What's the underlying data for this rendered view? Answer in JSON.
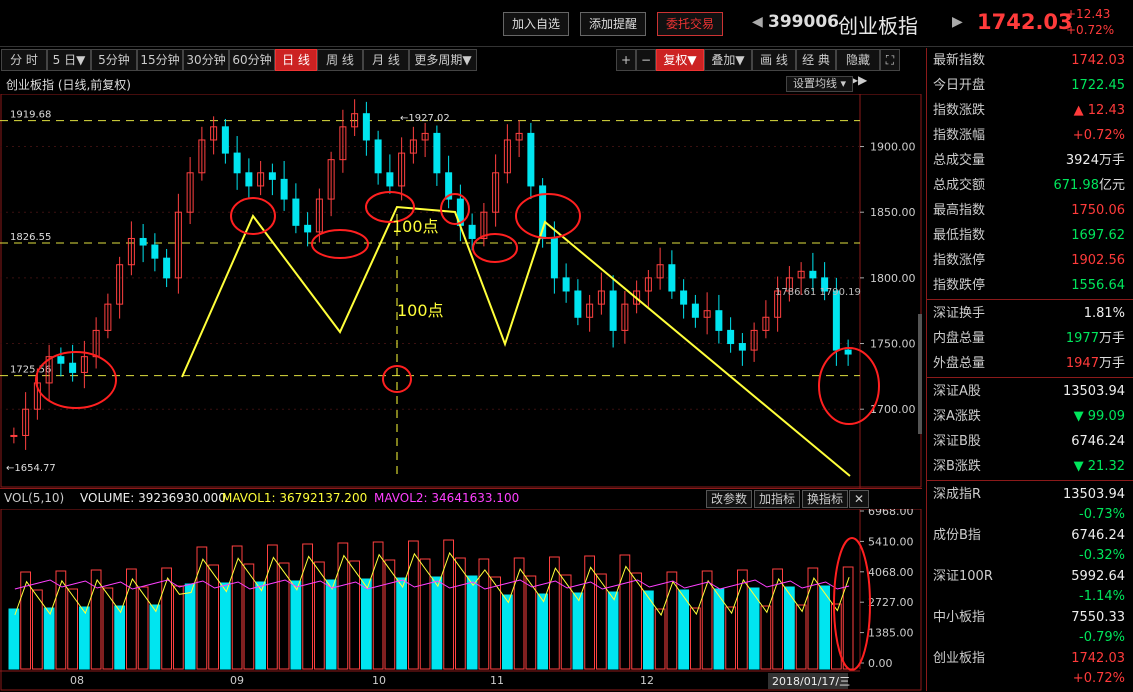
{
  "header": {
    "buttons": [
      "加入自选",
      "添加提醒",
      "委托交易"
    ],
    "code": "399006",
    "name": "创业板指",
    "price": "1742.03",
    "change": "+12.43",
    "change_pct": "+0.72%",
    "prev_arrow": "◀",
    "next_arrow": "▶"
  },
  "toolbar": {
    "left_tabs": [
      "分 时",
      "5 日▼",
      "5分钟",
      "15分钟",
      "30分钟",
      "60分钟",
      "日 线",
      "周 线",
      "月 线",
      "更多周期▼"
    ],
    "active_tab": "日 线",
    "right_tools": [
      "+",
      "−",
      "复权▼",
      "叠加▼",
      "画 线",
      "经 典",
      "隐藏▶▶",
      "⛶"
    ],
    "active_tool": "复权▼"
  },
  "chart_title": "创业板指 (日线,前复权)",
  "ma_setting": "设置均线",
  "price_levels": {
    "high_label": "1919.68",
    "mid_label": "1826.55",
    "low_label": "1725.56",
    "min_label": "←1654.77",
    "peak_label": "←1927.02",
    "right_labels": "1786.61 1790.19"
  },
  "annotations": {
    "hundred1": "100点",
    "hundred2": "100点"
  },
  "price_axis": [
    "1900.00",
    "1850.00",
    "1800.00",
    "1750.00",
    "1700.00"
  ],
  "volume": {
    "label": "VOL(5,10)",
    "volume_text": "VOLUME: 39236930.000",
    "mavol1": "MAVOL1: 36792137.200",
    "mavol2": "MAVOL2: 34641633.100",
    "buttons": [
      "改参数",
      "加指标",
      "换指标",
      "✕"
    ],
    "axis": [
      "6968.00",
      "5410.00",
      "4068.00",
      "2727.00",
      "1385.00",
      "0.00"
    ]
  },
  "x_axis": [
    "08",
    "09",
    "10",
    "11",
    "12"
  ],
  "x_date": "2018/01/17/三",
  "right_panel": {
    "group1": [
      {
        "label": "最新指数",
        "value": "1742.03",
        "color": "red"
      },
      {
        "label": "今日开盘",
        "value": "1722.45",
        "color": "green"
      },
      {
        "label": "指数涨跌",
        "value": "▲ 12.43",
        "color": "red"
      },
      {
        "label": "指数涨幅",
        "value": "+0.72%",
        "color": "red"
      },
      {
        "label": "总成交量",
        "value": "3924",
        "unit": "万手",
        "color": "white"
      },
      {
        "label": "总成交额",
        "value": "671.98",
        "unit": "亿元",
        "color": "green"
      },
      {
        "label": "最高指数",
        "value": "1750.06",
        "color": "red"
      },
      {
        "label": "最低指数",
        "value": "1697.62",
        "color": "green"
      },
      {
        "label": "指数涨停",
        "value": "1902.56",
        "color": "red"
      },
      {
        "label": "指数跌停",
        "value": "1556.64",
        "color": "green"
      }
    ],
    "group2": [
      {
        "label": "深证换手",
        "value": "1.81%",
        "color": "white"
      },
      {
        "label": "内盘总量",
        "value": "1977",
        "unit": "万手",
        "color": "green"
      },
      {
        "label": "外盘总量",
        "value": "1947",
        "unit": "万手",
        "color": "red"
      }
    ],
    "group3": [
      {
        "label": "深证A股",
        "value": "13503.94",
        "color": "white"
      },
      {
        "label": "深A涨跌",
        "value": "▼ 99.09",
        "color": "green"
      },
      {
        "label": "深证B股",
        "value": "6746.24",
        "color": "white"
      },
      {
        "label": "深B涨跌",
        "value": "▼ 21.32",
        "color": "green"
      }
    ],
    "group4": [
      {
        "label": "深成指R",
        "value": "13503.94",
        "value2": "-0.73%",
        "c1": "white",
        "c2": "green"
      },
      {
        "label": "成份B指",
        "value": "6746.24",
        "value2": "-0.32%",
        "c1": "white",
        "c2": "green"
      },
      {
        "label": "深证100R",
        "value": "5992.64",
        "value2": "-1.14%",
        "c1": "white",
        "c2": "green"
      },
      {
        "label": "中小板指",
        "value": "7550.33",
        "value2": "-0.79%",
        "c1": "white",
        "c2": "green"
      },
      {
        "label": "创业板指",
        "value": "1742.03",
        "value2": "+0.72%",
        "c1": "red",
        "c2": "red"
      }
    ]
  },
  "colors": {
    "up": "#ff4040",
    "down": "#00e5f0",
    "ma_yellow": "#ffff3a",
    "ma_magenta": "#ff40ff",
    "annotation": "#ff2020"
  }
}
